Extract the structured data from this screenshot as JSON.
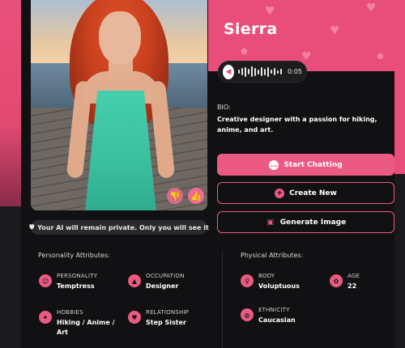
{
  "character": {
    "name": "Sierra",
    "audio_duration": "0:05",
    "bio_label": "BIO:",
    "bio_text": "Creative designer with a passion for hiking, anime, and art."
  },
  "privacy_notice": "Your AI will remain private. Only you will see it",
  "actions": {
    "start_chatting": "Start Chatting",
    "create_new": "Create New",
    "generate_image": "Generate Image"
  },
  "personality": {
    "title": "Personality Attributes:",
    "items": [
      {
        "label": "PERSONALITY",
        "value": "Temptress",
        "icon": "mask-icon"
      },
      {
        "label": "OCCUPATION",
        "value": "Designer",
        "icon": "graduation-cap-icon"
      },
      {
        "label": "HOBBIES",
        "value": "Hiking / Anime / Art",
        "icon": "hobbies-icon"
      },
      {
        "label": "RELATIONSHIP",
        "value": "Step Sister",
        "icon": "relationship-icon"
      }
    ]
  },
  "physical": {
    "title": "Physical Attributes:",
    "items": [
      {
        "label": "BODY",
        "value": "Voluptuous",
        "icon": "body-icon"
      },
      {
        "label": "AGE",
        "value": "22",
        "icon": "age-icon"
      },
      {
        "label": "ETHNICITY",
        "value": "Caucasian",
        "icon": "globe-icon"
      }
    ]
  },
  "colors": {
    "accent": "#ea5a83",
    "header_bg": "#e84e79",
    "page_bg": "#111113"
  }
}
